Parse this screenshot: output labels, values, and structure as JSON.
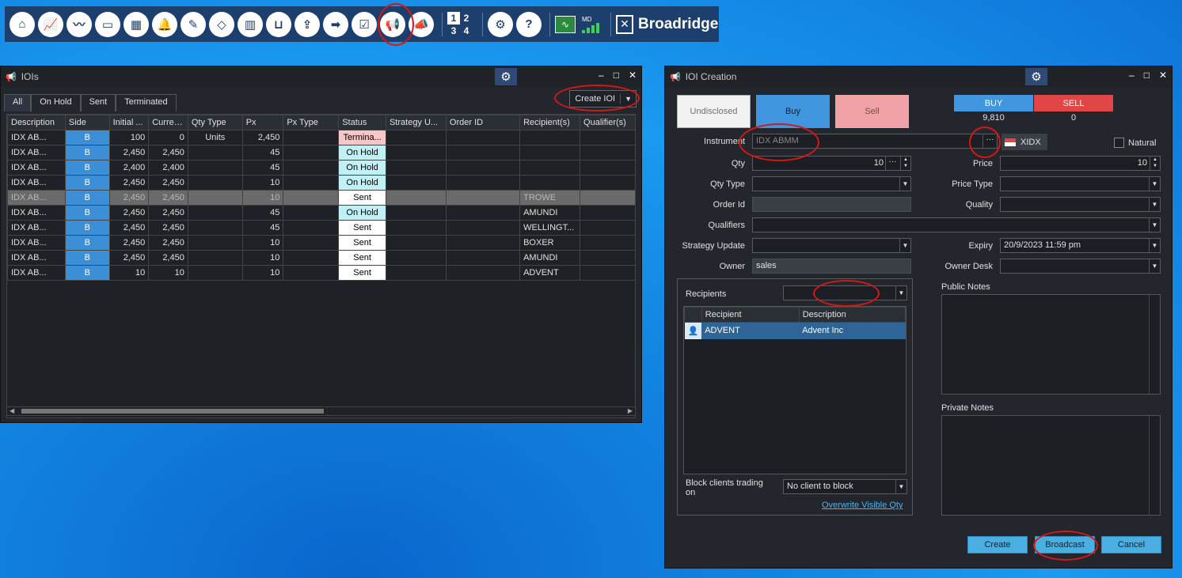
{
  "toolbar": {
    "icons": [
      "home-icon",
      "chart-icon",
      "pulse-icon",
      "folder-icon",
      "calculator-icon",
      "bell-icon",
      "pen-icon",
      "cube-icon",
      "building-icon",
      "basket-icon",
      "document-export-icon",
      "arrow-right-icon",
      "checklist-icon",
      "megaphone-icon",
      "megaphone-send-icon"
    ],
    "layout_cells": [
      "1",
      "2",
      "3",
      "4"
    ],
    "md_label": "MD",
    "brand": "Broadridge"
  },
  "iois_window": {
    "title": "IOIs",
    "tabs": [
      "All",
      "On Hold",
      "Sent",
      "Terminated"
    ],
    "create_button": "Create IOI",
    "columns": [
      "Description",
      "Side",
      "Initial ...",
      "Curren...",
      "Qty Type",
      "Px",
      "Px Type",
      "Status",
      "Strategy U...",
      "Order ID",
      "Recipient(s)",
      "Qualifier(s)"
    ],
    "rows": [
      {
        "description": "IDX AB...",
        "side": "B",
        "initial": "100",
        "current": "0",
        "qty_type": "Units",
        "px": "2,450",
        "px_type": "",
        "status": "Termina...",
        "status_kind": "term",
        "strategy": "",
        "order_id": "",
        "recipients": "",
        "qualifiers": ""
      },
      {
        "description": "IDX AB...",
        "side": "B",
        "initial": "2,450",
        "current": "2,450",
        "qty_type": "",
        "px": "45",
        "px_type": "",
        "status": "On Hold",
        "status_kind": "hold",
        "strategy": "",
        "order_id": "",
        "recipients": "",
        "qualifiers": ""
      },
      {
        "description": "IDX AB...",
        "side": "B",
        "initial": "2,400",
        "current": "2,400",
        "qty_type": "",
        "px": "45",
        "px_type": "",
        "status": "On Hold",
        "status_kind": "hold",
        "strategy": "",
        "order_id": "",
        "recipients": "",
        "qualifiers": ""
      },
      {
        "description": "IDX AB...",
        "side": "B",
        "initial": "2,450",
        "current": "2,450",
        "qty_type": "",
        "px": "10",
        "px_type": "",
        "status": "On Hold",
        "status_kind": "hold",
        "strategy": "",
        "order_id": "",
        "recipients": "",
        "qualifiers": ""
      },
      {
        "description": "IDX AB...",
        "side": "B",
        "initial": "2,450",
        "current": "2,450",
        "qty_type": "",
        "px": "10",
        "px_type": "",
        "status": "Sent",
        "status_kind": "Sent",
        "strategy": "",
        "order_id": "",
        "recipients": "TROWE",
        "qualifiers": "",
        "selected": true
      },
      {
        "description": "IDX AB...",
        "side": "B",
        "initial": "2,450",
        "current": "2,450",
        "qty_type": "",
        "px": "45",
        "px_type": "",
        "status": "On Hold",
        "status_kind": "hold",
        "strategy": "",
        "order_id": "",
        "recipients": "AMUNDI",
        "qualifiers": ""
      },
      {
        "description": "IDX AB...",
        "side": "B",
        "initial": "2,450",
        "current": "2,450",
        "qty_type": "",
        "px": "45",
        "px_type": "",
        "status": "Sent",
        "status_kind": "Sent",
        "strategy": "",
        "order_id": "",
        "recipients": "WELLINGT...",
        "qualifiers": ""
      },
      {
        "description": "IDX AB...",
        "side": "B",
        "initial": "2,450",
        "current": "2,450",
        "qty_type": "",
        "px": "10",
        "px_type": "",
        "status": "Sent",
        "status_kind": "Sent",
        "strategy": "",
        "order_id": "",
        "recipients": "BOXER",
        "qualifiers": ""
      },
      {
        "description": "IDX AB...",
        "side": "B",
        "initial": "2,450",
        "current": "2,450",
        "qty_type": "",
        "px": "10",
        "px_type": "",
        "status": "Sent",
        "status_kind": "Sent",
        "strategy": "",
        "order_id": "",
        "recipients": "AMUNDI",
        "qualifiers": ""
      },
      {
        "description": "IDX AB...",
        "side": "B",
        "initial": "10",
        "current": "10",
        "qty_type": "",
        "px": "10",
        "px_type": "",
        "status": "Sent",
        "status_kind": "Sent",
        "strategy": "",
        "order_id": "",
        "recipients": "ADVENT",
        "qualifiers": ""
      }
    ]
  },
  "creation_window": {
    "title": "IOI Creation",
    "side_buttons": {
      "undisclosed": "Undisclosed",
      "buy": "Buy",
      "sell": "Sell"
    },
    "market": {
      "buy_label": "BUY",
      "sell_label": "SELL",
      "buy_value": "9,810",
      "sell_value": "0"
    },
    "labels": {
      "instrument": "Instrument",
      "qty": "Qty",
      "qty_type": "Qty Type",
      "order_id": "Order Id",
      "qualifiers": "Qualifiers",
      "strategy_update": "Strategy Update",
      "owner": "Owner",
      "price": "Price",
      "price_type": "Price Type",
      "quality": "Quality",
      "expiry": "Expiry",
      "owner_desk": "Owner Desk",
      "natural": "Natural",
      "recipients": "Recipients",
      "public_notes": "Public Notes",
      "private_notes": "Private Notes",
      "block_clients": "Block clients trading on"
    },
    "values": {
      "instrument": "IDX ABMM",
      "exchange": "XIDX",
      "qty": "10",
      "price": "10",
      "expiry": "20/9/2023 11:59 pm",
      "owner": "sales",
      "block_clients": "No client to block"
    },
    "recipient_columns": [
      "Recipient",
      "Description"
    ],
    "recipient_rows": [
      {
        "recipient": "ADVENT",
        "description": "Advent Inc"
      }
    ],
    "overwrite_link": "Overwrite Visible Qty",
    "buttons": {
      "create": "Create",
      "broadcast": "Broadcast",
      "cancel": "Cancel"
    }
  },
  "colors": {
    "buy": "#3c8ed6",
    "sell": "#e04646",
    "accent": "#4aaee0",
    "annotation": "#d41818"
  }
}
